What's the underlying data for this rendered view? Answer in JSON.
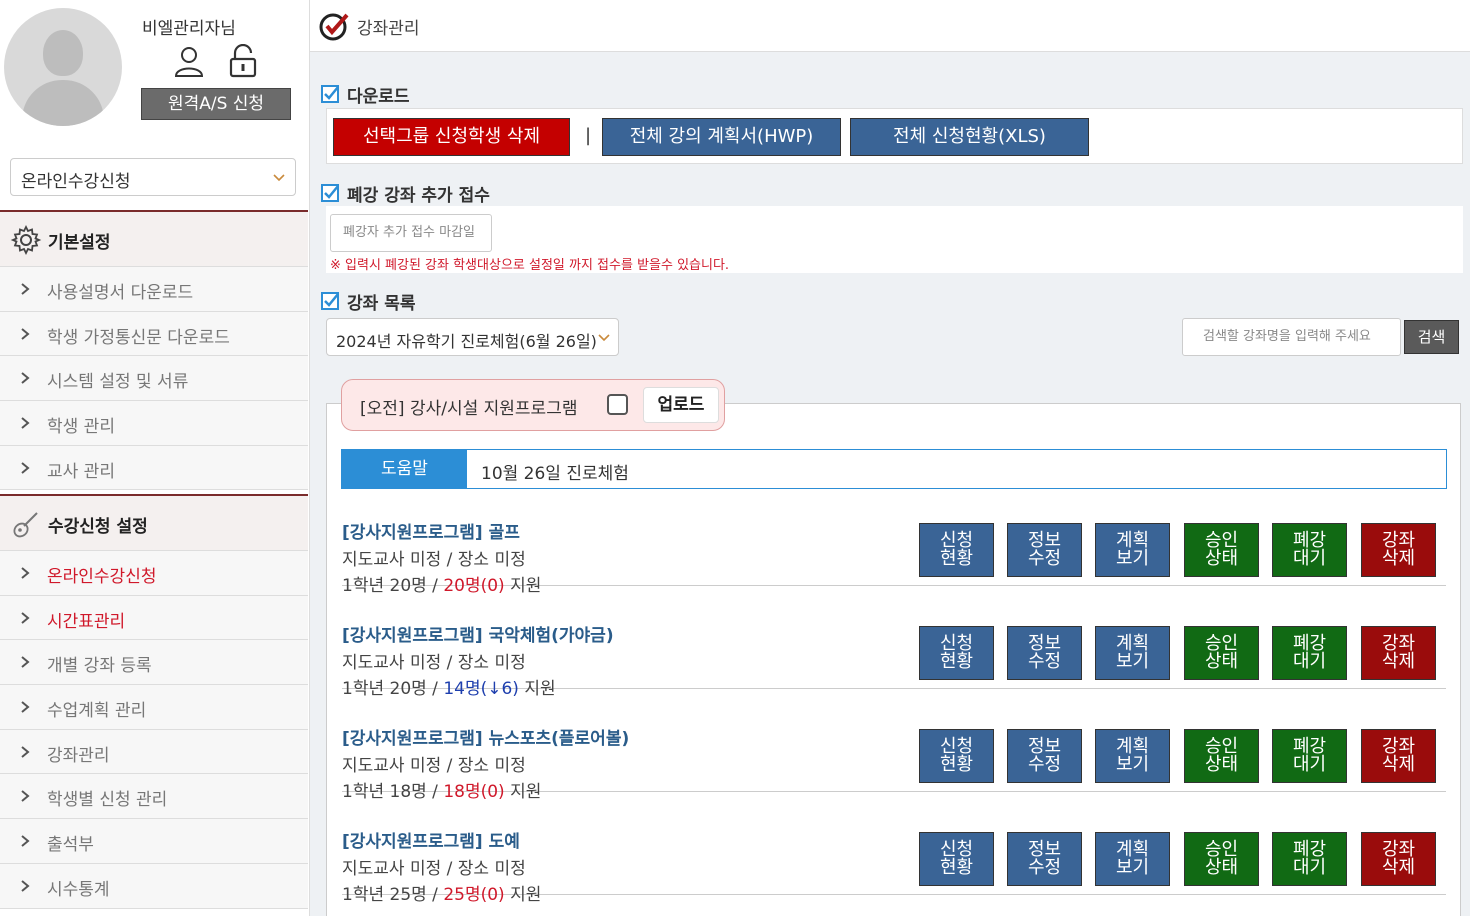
{
  "profile": {
    "admin_name": "비엘관리자님",
    "remote_button": "원격A/S 신청"
  },
  "sidebar": {
    "selected_program": "온라인수강신청",
    "groups": [
      {
        "title": "기본설정",
        "items": [
          "사용설명서 다운로드",
          "학생 가정통신문 다운로드",
          "시스템 설정 및 서류",
          "학생 관리",
          "교사 관리"
        ]
      },
      {
        "title": "수강신청 설정",
        "items": [
          "온라인수강신청",
          "시간표관리",
          "개별 강좌 등록",
          "수업계획 관리",
          "강좌관리",
          "학생별 신청 관리",
          "출석부",
          "시수통계"
        ]
      }
    ]
  },
  "page": {
    "title": "강좌관리"
  },
  "download": {
    "title": "다운로드",
    "delete_button": "선택그룹 신청학생 삭제",
    "separator": "|",
    "plan_button": "전체 강의 계획서(HWP)",
    "status_button": "전체 신청현황(XLS)"
  },
  "closed": {
    "title": "폐강 강좌 추가 접수",
    "input_placeholder": "폐강자 추가 접수 마감일",
    "note": "※ 입력시 폐강된 강좌 학생대상으로 설정일 까지 접수를 받을수 있습니다."
  },
  "course_list": {
    "title": "강좌 목록",
    "term_select": "2024년 자유학기 진로체험(6월 26일)",
    "search_placeholder": "검색할 강좌명을 입력해 주세요",
    "search_button": "검색",
    "program_tab": "[오전] 강사/시설 지원프로그램",
    "upload_button": "업로드",
    "help_label": "도움말",
    "help_text": "10월 26일 진로체험",
    "buttons": [
      "신청\n현황",
      "정보\n수정",
      "계획\n보기",
      "승인\n상태",
      "폐강\n대기",
      "강좌\n삭제"
    ],
    "courses": [
      {
        "title": "[강사지원프로그램] 골프",
        "info": "지도교사 미정 / 장소 미정",
        "grade": "1학년 20명",
        "slash": " / ",
        "applied": "20명(0)",
        "applied_color": "red",
        "suffix": " 지원"
      },
      {
        "title": "[강사지원프로그램] 국악체험(가야금)",
        "info": "지도교사 미정 / 장소 미정",
        "grade": "1학년 20명",
        "slash": " / ",
        "applied": "14명(↓6)",
        "applied_color": "blue",
        "suffix": " 지원"
      },
      {
        "title": "[강사지원프로그램] 뉴스포츠(플로어볼)",
        "info": "지도교사 미정 / 장소 미정",
        "grade": "1학년 18명",
        "slash": " / ",
        "applied": "18명(0)",
        "applied_color": "red",
        "suffix": " 지원"
      },
      {
        "title": "[강사지원프로그램] 도예",
        "info": "지도교사 미정 / 장소 미정",
        "grade": "1학년 25명",
        "slash": " / ",
        "applied": "25명(0)",
        "applied_color": "red",
        "suffix": " 지원"
      }
    ]
  }
}
